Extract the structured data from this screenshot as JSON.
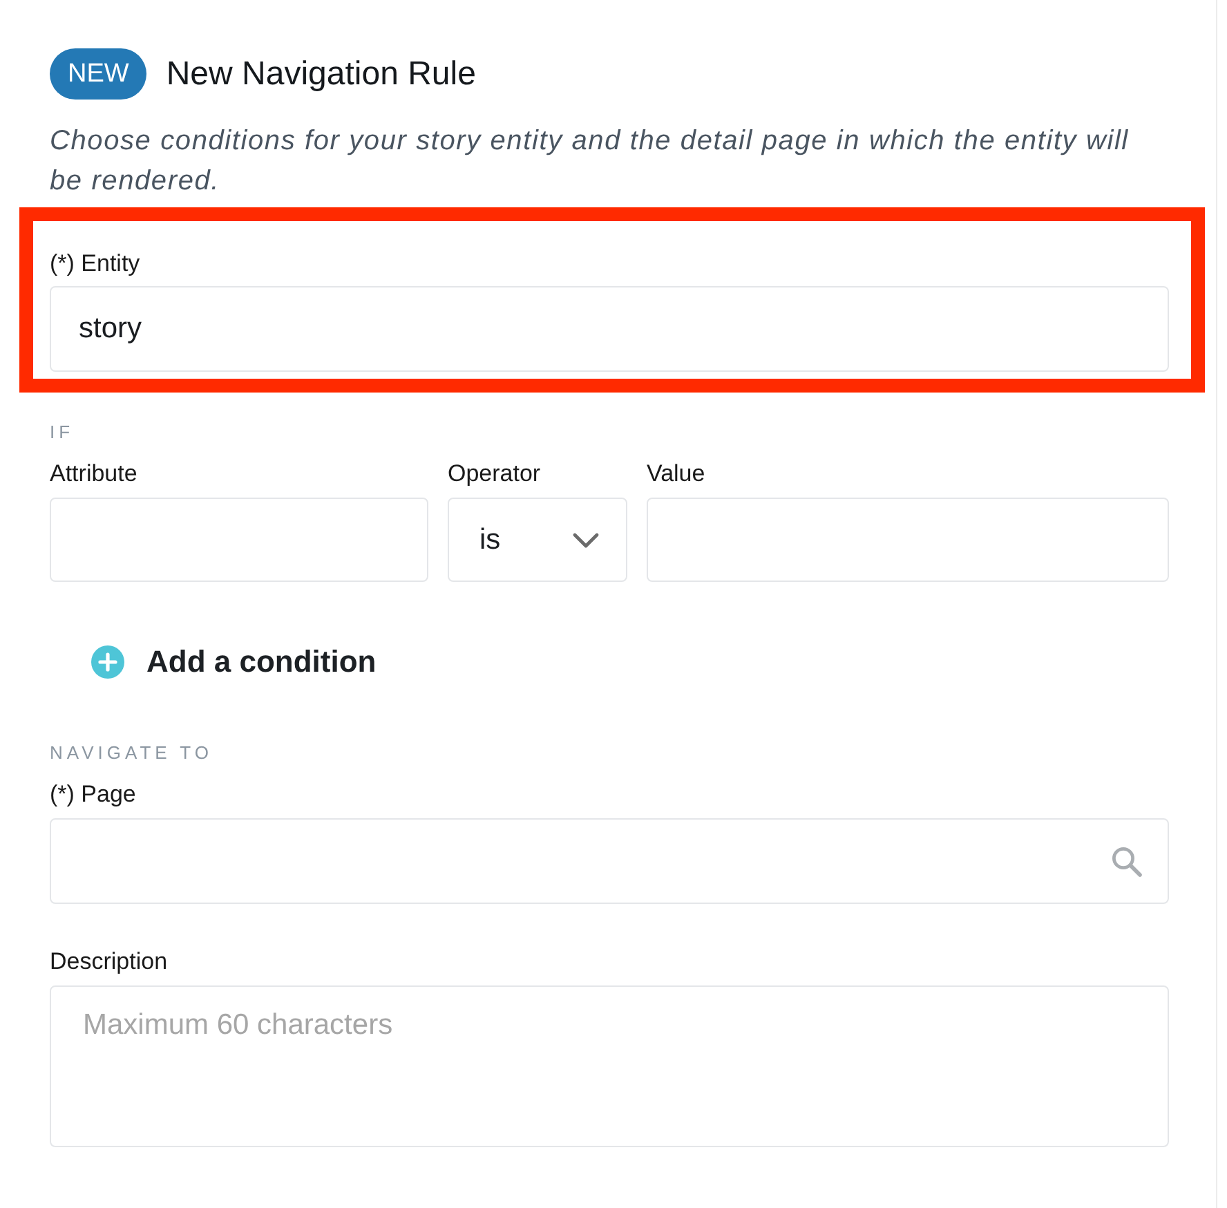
{
  "header": {
    "badge": "NEW",
    "title": "New Navigation Rule",
    "description": "Choose conditions for your story entity and the detail page in which the entity will be rendered."
  },
  "entity_field": {
    "label": "(*) Entity",
    "value": "story",
    "highlighted": true
  },
  "if_section": {
    "heading": "IF",
    "fields": [
      {
        "kind": "text",
        "label": "Attribute"
      },
      {
        "kind": "select",
        "label": "Operator",
        "value": "is"
      },
      {
        "kind": "text",
        "label": "Value"
      }
    ]
  },
  "add_condition": {
    "label": "Add a condition"
  },
  "navigate_section": {
    "heading": "NAVIGATE TO",
    "page_field": {
      "label": "(*) Page"
    }
  },
  "description_field": {
    "label": "Description",
    "placeholder": "Maximum 60 characters"
  }
}
